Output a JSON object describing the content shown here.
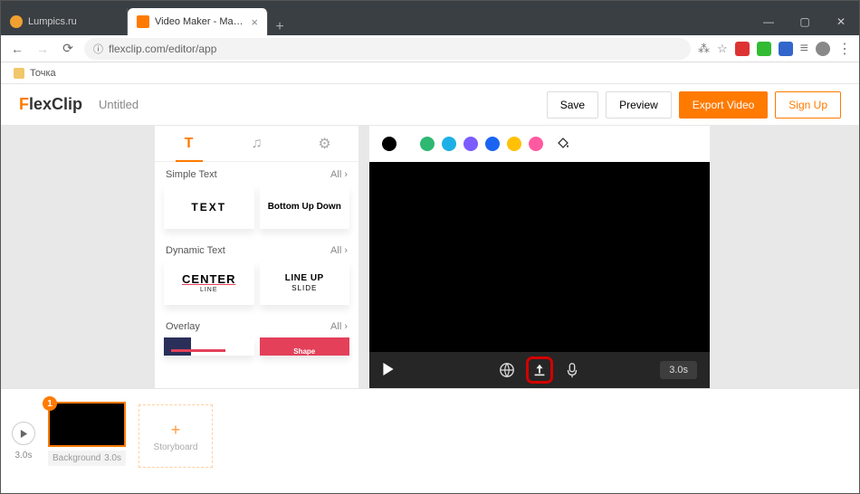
{
  "browser": {
    "tabs": [
      {
        "title": "Lumpics.ru",
        "icon_color": "#f0a030"
      },
      {
        "title": "Video Maker - Make a Video for",
        "icon_color": "#ff7a00"
      }
    ],
    "url": "flexclip.com/editor/app",
    "bookmark": "Точка"
  },
  "header": {
    "logo_f": "F",
    "logo_rest": "lexClip",
    "project_title": "Untitled",
    "save": "Save",
    "preview": "Preview",
    "export": "Export Video",
    "signup": "Sign Up"
  },
  "sidebar": {
    "sections": {
      "simple": {
        "title": "Simple Text",
        "all": "All ›"
      },
      "dynamic": {
        "title": "Dynamic Text",
        "all": "All ›"
      },
      "overlay": {
        "title": "Overlay",
        "all": "All ›"
      }
    },
    "cards": {
      "text": "TEXT",
      "bottomup": "Bottom Up Down",
      "center_main": "CENTER",
      "center_sub": "LINE",
      "lineup_main": "LINE UP",
      "lineup_sub": "SLIDE",
      "shape": "Shape"
    }
  },
  "colors": [
    "#000000",
    "#2eb872",
    "#1db0e6",
    "#7a5cff",
    "#1b64f2",
    "#ffc107",
    "#ff5aa0"
  ],
  "player": {
    "duration": "3.0s"
  },
  "timeline": {
    "play_duration": "3.0s",
    "clip": {
      "badge": "1",
      "label": "Background",
      "dur": "3.0s"
    },
    "add": "Storyboard"
  }
}
